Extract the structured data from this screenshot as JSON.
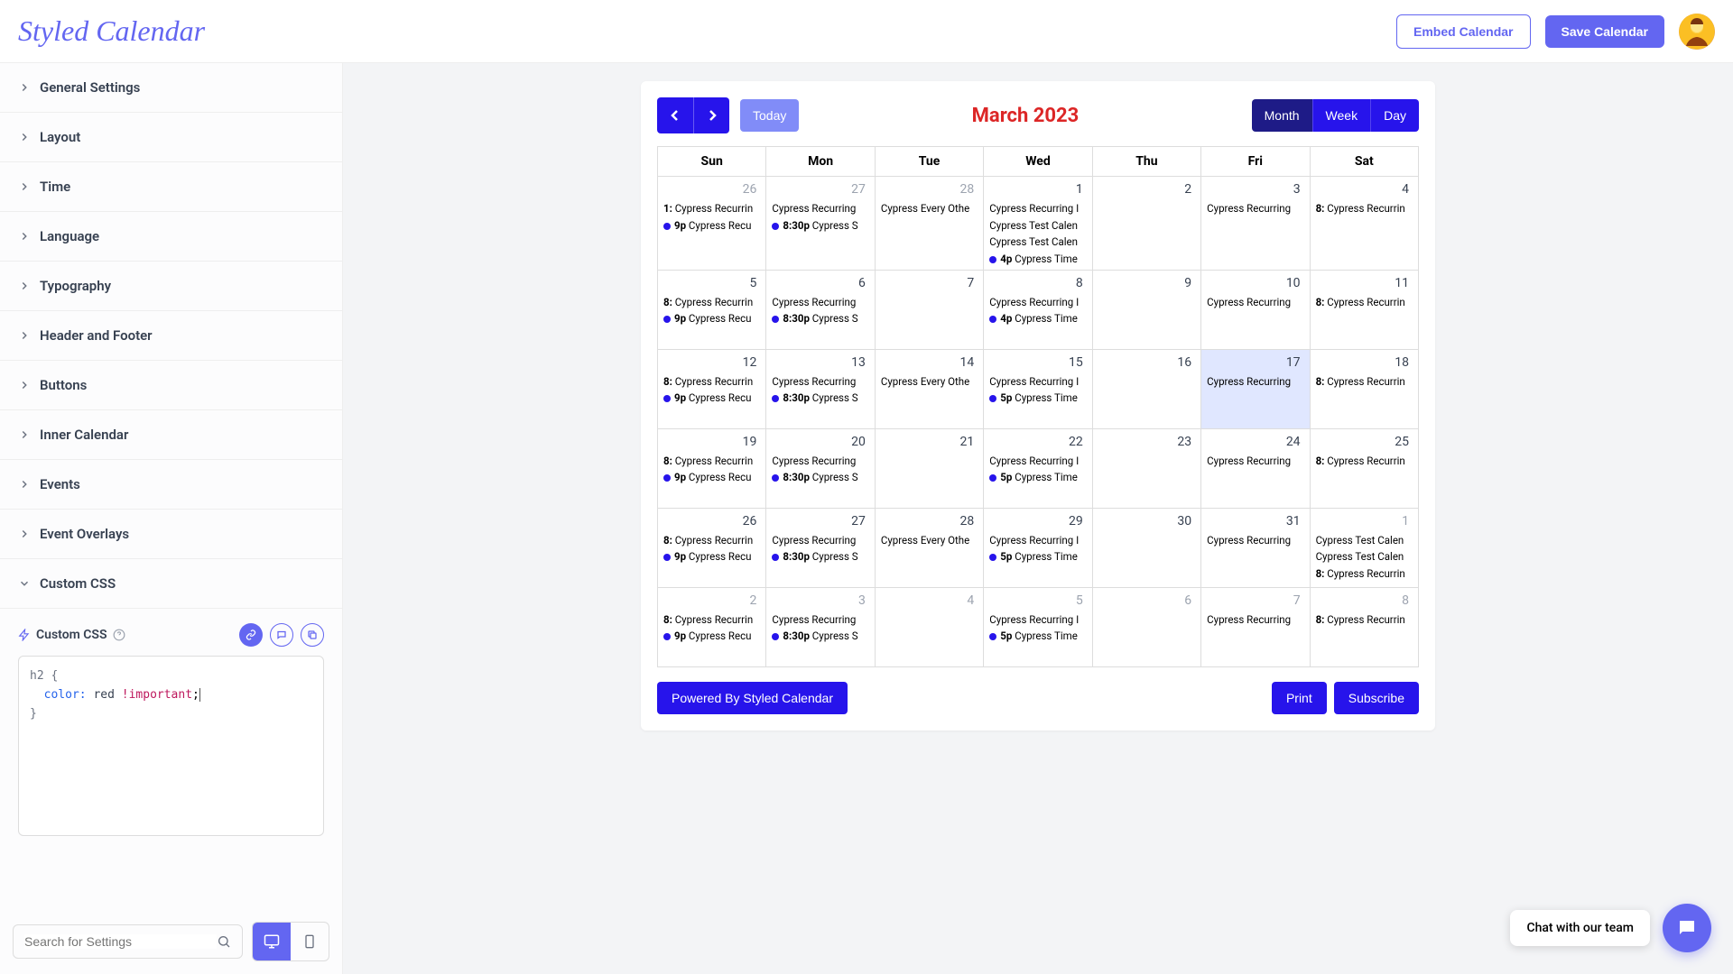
{
  "header": {
    "logo": "Styled Calendar",
    "embed": "Embed Calendar",
    "save": "Save Calendar"
  },
  "sidebar": {
    "items": [
      {
        "label": "General Settings",
        "expanded": false
      },
      {
        "label": "Layout",
        "expanded": false
      },
      {
        "label": "Time",
        "expanded": false
      },
      {
        "label": "Language",
        "expanded": false
      },
      {
        "label": "Typography",
        "expanded": false
      },
      {
        "label": "Header and Footer",
        "expanded": false
      },
      {
        "label": "Buttons",
        "expanded": false
      },
      {
        "label": "Inner Calendar",
        "expanded": false
      },
      {
        "label": "Events",
        "expanded": false
      },
      {
        "label": "Event Overlays",
        "expanded": false
      },
      {
        "label": "Custom CSS",
        "expanded": true
      }
    ],
    "customCss": {
      "title": "Custom CSS",
      "code": {
        "selector": "h2",
        "prop": "color",
        "val": "red",
        "imp": "!important"
      }
    },
    "search_placeholder": "Search for Settings"
  },
  "calendar": {
    "today_label": "Today",
    "title": "March 2023",
    "views": [
      "Month",
      "Week",
      "Day"
    ],
    "active_view": "Month",
    "day_headers": [
      "Sun",
      "Mon",
      "Tue",
      "Wed",
      "Thu",
      "Fri",
      "Sat"
    ],
    "weeks": [
      [
        {
          "num": "26",
          "other": true,
          "events": [
            {
              "prefix": "1:",
              "text": "Cypress Recurrin"
            },
            {
              "dot": true,
              "time": "9p",
              "text": "Cypress Recu"
            }
          ]
        },
        {
          "num": "27",
          "other": true,
          "events": [
            {
              "text": "Cypress Recurring"
            },
            {
              "dot": true,
              "time": "8:30p",
              "text": "Cypress S"
            }
          ]
        },
        {
          "num": "28",
          "other": true,
          "events": [
            {
              "text": "Cypress Every Othe"
            }
          ]
        },
        {
          "num": "1",
          "events": [
            {
              "text": "Cypress Recurring I"
            },
            {
              "text": "Cypress Test Calen"
            },
            {
              "text": "Cypress Test Calen"
            },
            {
              "dot": true,
              "time": "4p",
              "text": "Cypress Time"
            }
          ]
        },
        {
          "num": "2",
          "events": []
        },
        {
          "num": "3",
          "events": [
            {
              "text": "Cypress Recurring"
            }
          ]
        },
        {
          "num": "4",
          "events": [
            {
              "prefix": "8:",
              "text": "Cypress Recurrin"
            }
          ]
        }
      ],
      [
        {
          "num": "5",
          "events": [
            {
              "prefix": "8:",
              "text": "Cypress Recurrin"
            },
            {
              "dot": true,
              "time": "9p",
              "text": "Cypress Recu"
            }
          ]
        },
        {
          "num": "6",
          "events": [
            {
              "text": "Cypress Recurring"
            },
            {
              "dot": true,
              "time": "8:30p",
              "text": "Cypress S"
            }
          ]
        },
        {
          "num": "7",
          "events": []
        },
        {
          "num": "8",
          "events": [
            {
              "text": "Cypress Recurring I"
            },
            {
              "dot": true,
              "time": "4p",
              "text": "Cypress Time"
            }
          ]
        },
        {
          "num": "9",
          "events": []
        },
        {
          "num": "10",
          "events": [
            {
              "text": "Cypress Recurring"
            }
          ]
        },
        {
          "num": "11",
          "events": [
            {
              "prefix": "8:",
              "text": "Cypress Recurrin"
            }
          ]
        }
      ],
      [
        {
          "num": "12",
          "events": [
            {
              "prefix": "8:",
              "text": "Cypress Recurrin"
            },
            {
              "dot": true,
              "time": "9p",
              "text": "Cypress Recu"
            }
          ]
        },
        {
          "num": "13",
          "events": [
            {
              "text": "Cypress Recurring"
            },
            {
              "dot": true,
              "time": "8:30p",
              "text": "Cypress S"
            }
          ]
        },
        {
          "num": "14",
          "events": [
            {
              "text": "Cypress Every Othe"
            }
          ]
        },
        {
          "num": "15",
          "events": [
            {
              "text": "Cypress Recurring I"
            },
            {
              "dot": true,
              "time": "5p",
              "text": "Cypress Time"
            }
          ]
        },
        {
          "num": "16",
          "events": []
        },
        {
          "num": "17",
          "today": true,
          "events": [
            {
              "text": "Cypress Recurring"
            }
          ]
        },
        {
          "num": "18",
          "events": [
            {
              "prefix": "8:",
              "text": "Cypress Recurrin"
            }
          ]
        }
      ],
      [
        {
          "num": "19",
          "events": [
            {
              "prefix": "8:",
              "text": "Cypress Recurrin"
            },
            {
              "dot": true,
              "time": "9p",
              "text": "Cypress Recu"
            }
          ]
        },
        {
          "num": "20",
          "events": [
            {
              "text": "Cypress Recurring"
            },
            {
              "dot": true,
              "time": "8:30p",
              "text": "Cypress S"
            }
          ]
        },
        {
          "num": "21",
          "events": []
        },
        {
          "num": "22",
          "events": [
            {
              "text": "Cypress Recurring I"
            },
            {
              "dot": true,
              "time": "5p",
              "text": "Cypress Time"
            }
          ]
        },
        {
          "num": "23",
          "events": []
        },
        {
          "num": "24",
          "events": [
            {
              "text": "Cypress Recurring"
            }
          ]
        },
        {
          "num": "25",
          "events": [
            {
              "prefix": "8:",
              "text": "Cypress Recurrin"
            }
          ]
        }
      ],
      [
        {
          "num": "26",
          "events": [
            {
              "prefix": "8:",
              "text": "Cypress Recurrin"
            },
            {
              "dot": true,
              "time": "9p",
              "text": "Cypress Recu"
            }
          ]
        },
        {
          "num": "27",
          "events": [
            {
              "text": "Cypress Recurring"
            },
            {
              "dot": true,
              "time": "8:30p",
              "text": "Cypress S"
            }
          ]
        },
        {
          "num": "28",
          "events": [
            {
              "text": "Cypress Every Othe"
            }
          ]
        },
        {
          "num": "29",
          "events": [
            {
              "text": "Cypress Recurring I"
            },
            {
              "dot": true,
              "time": "5p",
              "text": "Cypress Time"
            }
          ]
        },
        {
          "num": "30",
          "events": []
        },
        {
          "num": "31",
          "events": [
            {
              "text": "Cypress Recurring"
            }
          ]
        },
        {
          "num": "1",
          "other": true,
          "events": [
            {
              "text": "Cypress Test Calen"
            },
            {
              "text": "Cypress Test Calen"
            },
            {
              "prefix": "8:",
              "text": "Cypress Recurrin"
            }
          ]
        }
      ],
      [
        {
          "num": "2",
          "other": true,
          "events": [
            {
              "prefix": "8:",
              "text": "Cypress Recurrin"
            },
            {
              "dot": true,
              "time": "9p",
              "text": "Cypress Recu"
            }
          ]
        },
        {
          "num": "3",
          "other": true,
          "events": [
            {
              "text": "Cypress Recurring"
            },
            {
              "dot": true,
              "time": "8:30p",
              "text": "Cypress S"
            }
          ]
        },
        {
          "num": "4",
          "other": true,
          "events": []
        },
        {
          "num": "5",
          "other": true,
          "events": [
            {
              "text": "Cypress Recurring I"
            },
            {
              "dot": true,
              "time": "5p",
              "text": "Cypress Time"
            }
          ]
        },
        {
          "num": "6",
          "other": true,
          "events": []
        },
        {
          "num": "7",
          "other": true,
          "events": [
            {
              "text": "Cypress Recurring"
            }
          ]
        },
        {
          "num": "8",
          "other": true,
          "events": [
            {
              "prefix": "8:",
              "text": "Cypress Recurrin"
            }
          ]
        }
      ]
    ],
    "footer": {
      "powered": "Powered By Styled Calendar",
      "print": "Print",
      "subscribe": "Subscribe"
    }
  },
  "chat": {
    "text": "Chat with our team"
  }
}
